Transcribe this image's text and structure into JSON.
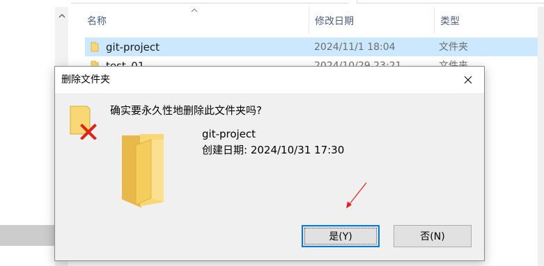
{
  "explorer": {
    "columns": [
      {
        "label": "名称"
      },
      {
        "label": "修改日期"
      },
      {
        "label": "类型"
      }
    ],
    "rows": [
      {
        "name": "git-project",
        "date": "2024/11/1 18:04",
        "type": "文件夹",
        "selected": true
      },
      {
        "name": "test_01",
        "date": "2024/10/29 23:21",
        "type": "文件夹",
        "selected": false
      }
    ]
  },
  "dialog": {
    "title": "删除文件夹",
    "question": "确实要永久性地删除此文件夹吗?",
    "item_name": "git-project",
    "item_created": "创建日期: 2024/10/31 17:30",
    "buttons": {
      "yes": "是(Y)",
      "no": "否(N)"
    }
  },
  "colors": {
    "selection": "#cce8ff",
    "accent": "#0078d7",
    "folder": "#f8d775",
    "error_x": "#d8261c",
    "annotation": "#e02020"
  }
}
